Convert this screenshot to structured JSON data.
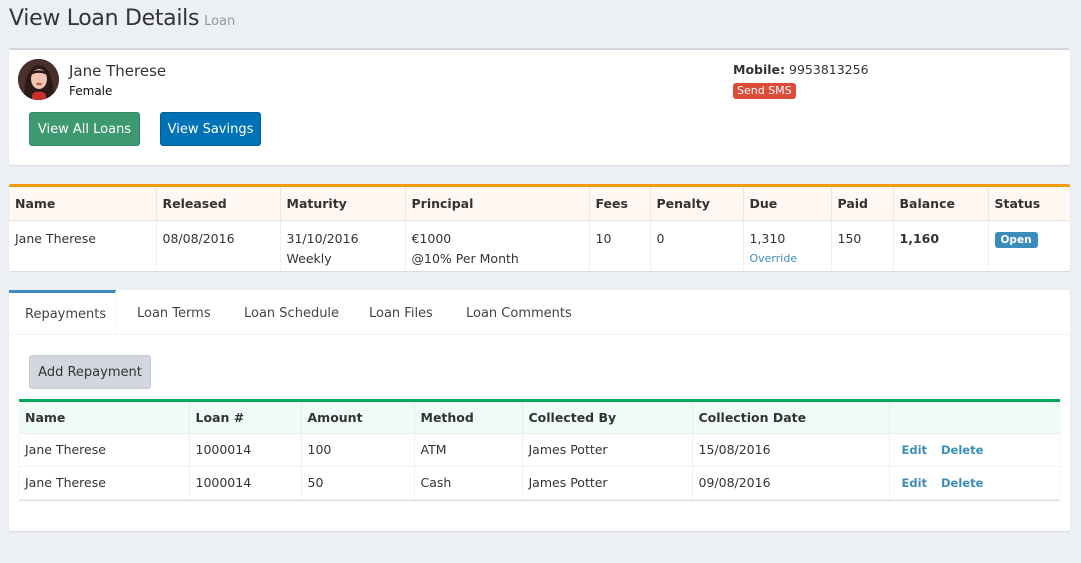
{
  "header": {
    "title": "View Loan Details",
    "subtitle": "Loan"
  },
  "borrower": {
    "name": "Jane Therese",
    "gender": "Female",
    "mobile_label": "Mobile:",
    "mobile": "9953813256",
    "send_sms": "Send SMS",
    "view_all_loans": "View All Loans",
    "view_savings": "View Savings"
  },
  "loan": {
    "headers": [
      "Name",
      "Released",
      "Maturity",
      "Principal",
      "Fees",
      "Penalty",
      "Due",
      "Paid",
      "Balance",
      "Status"
    ],
    "name": "Jane Therese",
    "released": "08/08/2016",
    "maturity": "31/10/2016",
    "frequency": "Weekly",
    "principal": "€1000",
    "interest": "@10% Per Month",
    "fees": "10",
    "penalty": "0",
    "due": "1,310",
    "override": "Override",
    "paid": "150",
    "balance": "1,160",
    "status": "Open"
  },
  "tabs": [
    "Repayments",
    "Loan Terms",
    "Loan Schedule",
    "Loan Files",
    "Loan Comments"
  ],
  "repayments": {
    "add_label": "Add Repayment",
    "headers": [
      "Name",
      "Loan #",
      "Amount",
      "Method",
      "Collected By",
      "Collection Date"
    ],
    "rows": [
      {
        "name": "Jane Therese",
        "loan_no": "1000014",
        "amount": "100",
        "method": "ATM",
        "collected_by": "James Potter",
        "date": "15/08/2016"
      },
      {
        "name": "Jane Therese",
        "loan_no": "1000014",
        "amount": "50",
        "method": "Cash",
        "collected_by": "James Potter",
        "date": "09/08/2016"
      }
    ],
    "edit_label": "Edit",
    "delete_label": "Delete"
  }
}
